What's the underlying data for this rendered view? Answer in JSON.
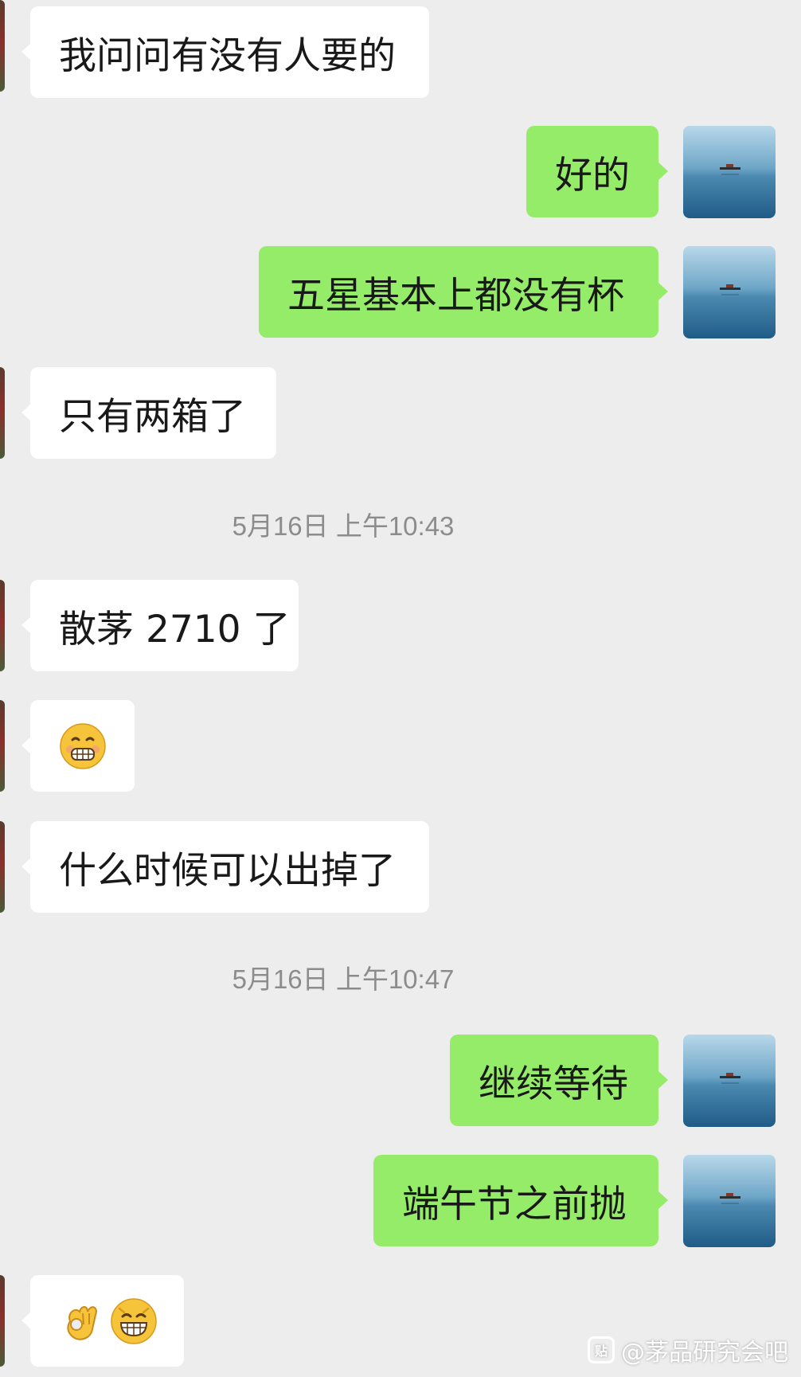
{
  "messages": [
    {
      "side": "in",
      "text": "我问问有没有人要的"
    },
    {
      "side": "out",
      "text": "好的"
    },
    {
      "side": "out",
      "text": "五星基本上都没有杯"
    },
    {
      "side": "in",
      "text": "只有两箱了"
    },
    {
      "side": "time",
      "text": "5月16日 上午10:43"
    },
    {
      "side": "in",
      "text": "散茅 2710 了"
    },
    {
      "side": "in",
      "emoji": [
        "grimace-emoji"
      ]
    },
    {
      "side": "in",
      "text": "什么时候可以出掉了"
    },
    {
      "side": "time",
      "text": "5月16日 上午10:47"
    },
    {
      "side": "out",
      "text": "继续等待"
    },
    {
      "side": "out",
      "text": "端午节之前抛"
    },
    {
      "side": "in",
      "emoji": [
        "ok-hand-emoji",
        "grin-emoji"
      ]
    }
  ],
  "watermark": {
    "text": "@茅品研究会吧",
    "icon": "tieba-icon",
    "icon_glyph": "贴"
  },
  "colors": {
    "background": "#ededed",
    "incoming_bubble": "#ffffff",
    "outgoing_bubble": "#95ec69",
    "timestamp_text": "#8c8c8c"
  }
}
